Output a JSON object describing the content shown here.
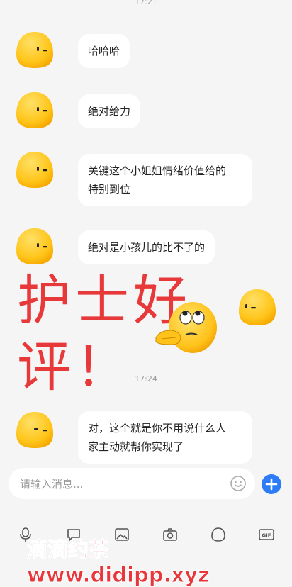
{
  "chat": {
    "top_time": "17:21",
    "messages": [
      {
        "text": "哈哈哈"
      },
      {
        "text": "绝对给力"
      },
      {
        "text": "关键这个小姐姐情绪价值给的\n特别到位"
      },
      {
        "text": "绝对是小孩儿的比不了的"
      }
    ],
    "overlay_line1": "护士好",
    "overlay_line2": "评！",
    "mid_time": "17:24",
    "last_message": "对，这个就是你不用说什么人\n家主动就帮你实现了"
  },
  "composer": {
    "placeholder": "请输入消息...",
    "emoji_icon": "emoji-icon",
    "plus_icon": "plus-icon"
  },
  "toolbar": {
    "icons": [
      "mic-icon",
      "chat-icon",
      "image-icon",
      "camera-icon",
      "emoji-face-icon",
      "gif-icon"
    ]
  },
  "watermark": "滴滴约茶 www.didipp.xyz",
  "colors": {
    "avatar": "#ffc81a",
    "accent": "#2b7cf6",
    "overlay": "#e8393a"
  }
}
